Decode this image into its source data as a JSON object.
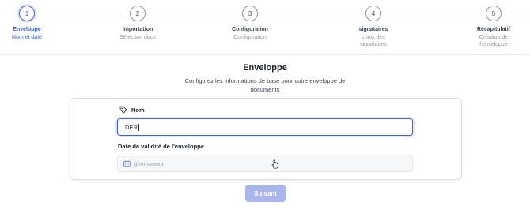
{
  "steps": [
    {
      "number": "1",
      "title": "Enveloppe",
      "subtitle": "Nom et date",
      "active": true
    },
    {
      "number": "2",
      "title": "Importation",
      "subtitle": "Sélection docs",
      "active": false
    },
    {
      "number": "3",
      "title": "Configuration",
      "subtitle": "Configuration",
      "active": false
    },
    {
      "number": "4",
      "title": "signataires",
      "subtitle": "choix des signataires",
      "active": false
    },
    {
      "number": "5",
      "title": "Récapitulatif",
      "subtitle": "Création de l'enveloppe",
      "active": false
    }
  ],
  "main": {
    "title": "Enveloppe",
    "description": "Configurez les informations de base pour votre enveloppe de documents"
  },
  "form": {
    "name_label": "Nom",
    "name_value": "DER",
    "date_label": "Date de validité de l'enveloppe",
    "date_placeholder": "jj/mm/aaaa"
  },
  "actions": {
    "next_label": "Suivant"
  },
  "colors": {
    "accent": "#3d62d6",
    "next_button_bg": "#a9b5ec"
  },
  "icons": {
    "name_field": "tag-icon",
    "date_field": "calendar-icon"
  }
}
